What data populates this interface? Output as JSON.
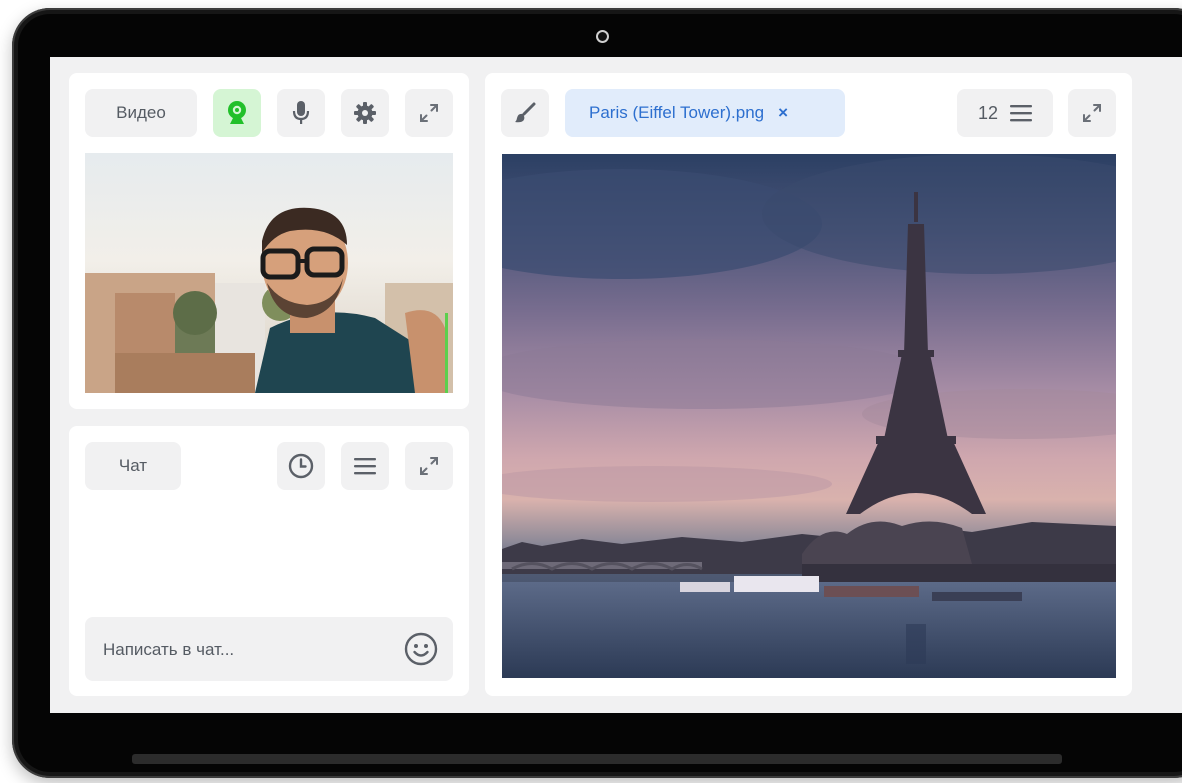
{
  "video_panel": {
    "title": "Видео",
    "buttons": [
      "webcam-icon",
      "microphone-icon",
      "gear-icon",
      "expand-icon"
    ],
    "webcam_active_color": "#22c02a"
  },
  "chat_panel": {
    "title": "Чат",
    "buttons": [
      "clock-icon",
      "menu-icon",
      "expand-icon"
    ],
    "input_placeholder": "Написать в чат...",
    "emoji_icon": "smiley-icon"
  },
  "doc_panel": {
    "brush_icon": "brush-icon",
    "file_tab": {
      "label": "Paris (Eiffel Tower).png",
      "close_label": "×"
    },
    "page_count": "12",
    "menu_icon": "menu-icon",
    "expand_icon": "expand-icon"
  },
  "colors": {
    "accent_blue": "#2d6fcf",
    "tab_bg": "#e1ecfb",
    "active_green_bg": "#d5f5d4",
    "button_bg": "#f1f1f2"
  }
}
